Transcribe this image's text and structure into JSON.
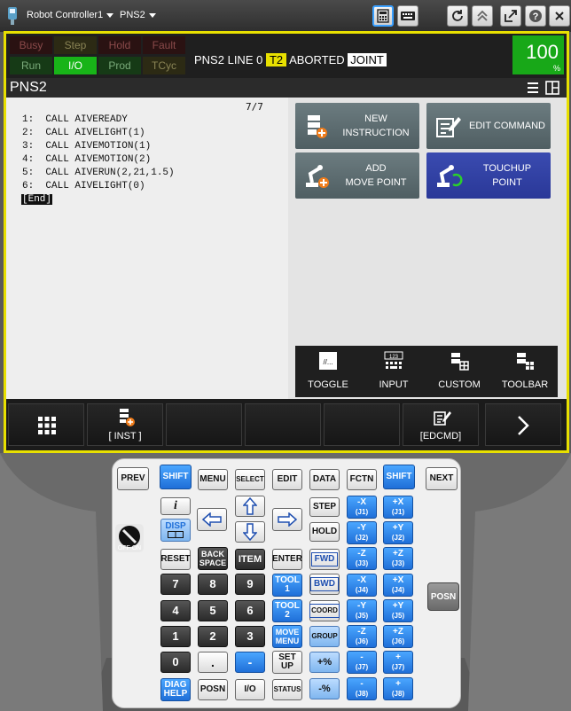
{
  "topbar": {
    "controller": "Robot Controller1",
    "program": "PNS2"
  },
  "status": {
    "indicators": [
      {
        "label": "Busy",
        "state": "off"
      },
      {
        "label": "Step",
        "state": "off"
      },
      {
        "label": "Hold",
        "state": "off"
      },
      {
        "label": "Fault",
        "state": "off"
      },
      {
        "label": "Run",
        "state": "off"
      },
      {
        "label": "I/O",
        "state": "on"
      },
      {
        "label": "Prod",
        "state": "off"
      },
      {
        "label": "TCyc",
        "state": "off"
      }
    ],
    "program": "PNS2",
    "line_label": "LINE",
    "line": "0",
    "mode": "T2",
    "state": "ABORTED",
    "coord": "JOINT",
    "override": "100",
    "override_unit": "%"
  },
  "editor": {
    "title": "PNS2",
    "line_count": "7/7",
    "lines": [
      "1:  CALL AIVEREADY",
      "2:  CALL AIVELIGHT(1)",
      "3:  CALL AIVEMOTION(1)",
      "4:  CALL AIVEMOTION(2)",
      "5:  CALL AIVERUN(2,21,1.5)",
      "6:  CALL AIVELIGHT(0)"
    ],
    "end_marker": "[End]"
  },
  "panel": {
    "new_instruction": [
      "NEW",
      "INSTRUCTION"
    ],
    "edit_command": "EDIT COMMAND",
    "add_move_point": [
      "ADD",
      "MOVE POINT"
    ],
    "touchup_point": [
      "TOUCHUP",
      "POINT"
    ],
    "toolbar": {
      "toggle": "TOGGLE",
      "input": "INPUT",
      "custom": "CUSTOM",
      "toolbar": "TOOLBAR",
      "input_icon_text": "123",
      "toggle_icon_text": "//..."
    }
  },
  "fkeys": {
    "inst": "[ INST ]",
    "edcmd": "[EDCMD]"
  },
  "keypad": {
    "prev": "PREV",
    "shift": "SHIFT",
    "menu": "MENU",
    "select": "SELECT",
    "edit": "EDIT",
    "data": "DATA",
    "fctn": "FCTN",
    "next": "NEXT",
    "info": "i",
    "disp": "DISP",
    "step": "STEP",
    "hold": "HOLD",
    "reset": "RESET",
    "back": "BACK",
    "space": "SPACE",
    "item": "ITEM",
    "enter": "ENTER",
    "fwd": "FWD",
    "bwd": "BWD",
    "tool": "TOOL",
    "one": "1",
    "two": "2",
    "coord": "COORD",
    "move": "MOVE",
    "menu2": "MENU",
    "group": "GROUP",
    "set": "SET",
    "up": "UP",
    "diag": "DIAG",
    "help": "HELP",
    "posn": "POSN",
    "io": "I/O",
    "status_key": "STATUS",
    "digits": [
      "7",
      "8",
      "9",
      "4",
      "5",
      "6",
      "1",
      "2",
      "3",
      "0",
      "."
    ],
    "minus_key": "-",
    "minus_pct": "-%",
    "plus_pct": "+%",
    "jog": [
      {
        "neg": "-X",
        "negj": "(J1)",
        "pos": "+X",
        "posj": "(J1)"
      },
      {
        "neg": "-Y",
        "negj": "(J2)",
        "pos": "+Y",
        "posj": "(J2)"
      },
      {
        "neg": "-Z",
        "negj": "(J3)",
        "pos": "+Z",
        "posj": "(J3)"
      },
      {
        "neg": "-X",
        "negj": "(J4)",
        "pos": "+X",
        "posj": "(J4)"
      },
      {
        "neg": "-Y",
        "negj": "(J5)",
        "pos": "+Y",
        "posj": "(J5)"
      },
      {
        "neg": "-Z",
        "negj": "(J6)",
        "pos": "+Z",
        "posj": "(J6)"
      },
      {
        "neg": "-",
        "negj": "(J7)",
        "pos": "+",
        "posj": "(J7)"
      },
      {
        "neg": "-",
        "negj": "(J8)",
        "pos": "+",
        "posj": "(J8)"
      }
    ],
    "side_posn": "POSN",
    "deadman_off": "OFF",
    "deadman_on": "ON"
  },
  "colors": {
    "frame": "#e8e000",
    "active_indicator": "#18b418",
    "touchup_button": "#2a3898",
    "shift_blue": "#1f6fd8"
  }
}
